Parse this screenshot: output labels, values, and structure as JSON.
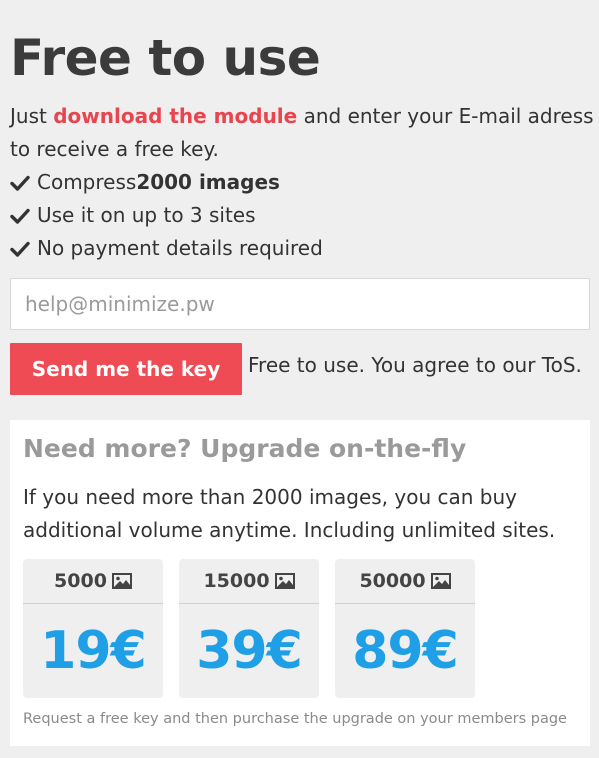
{
  "header": {
    "title": "Free to use"
  },
  "intro": {
    "before": "Just ",
    "link": "download the module",
    "after": " and enter your E-mail adress to receive a free key."
  },
  "features": {
    "item1_prefix": "Compress ",
    "item1_bold": "2000 images",
    "item2": "Use it on up to 3 sites",
    "item3": "No payment details required"
  },
  "form": {
    "email_placeholder": "help@minimize.pw",
    "email_value": "",
    "send_label": "Send me the key",
    "tos_text": "Free to use. You agree to our ToS."
  },
  "upgrade": {
    "title": "Need more? Upgrade on-the-fly",
    "description": "If you need more than 2000 images, you can buy additional volume anytime. Including unlimited sites.",
    "plans": [
      {
        "quantity": "5000",
        "price": "19€"
      },
      {
        "quantity": "15000",
        "price": "39€"
      },
      {
        "quantity": "50000",
        "price": "89€"
      }
    ],
    "footnote": "Request a free key and then purchase the upgrade on your members page"
  },
  "colors": {
    "accent": "#ef4b55",
    "price": "#1fa0e6",
    "link": "#e8454f"
  },
  "icons": {
    "check": "checkmark-icon",
    "image": "image-icon"
  }
}
